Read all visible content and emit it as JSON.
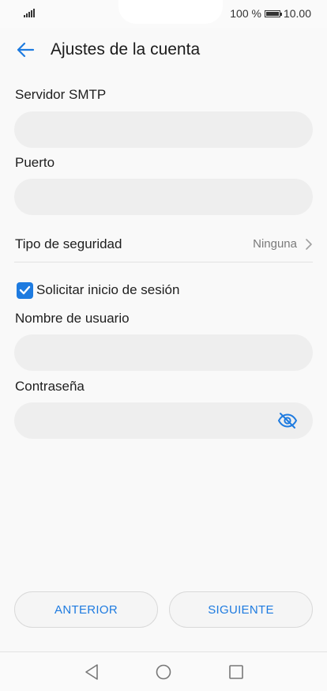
{
  "status_bar": {
    "battery_percent": "100 %",
    "time": "10.00",
    "battery_level": 1.0
  },
  "header": {
    "title": "Ajustes de la cuenta",
    "back_icon": "arrow-left-icon"
  },
  "form": {
    "smtp_server": {
      "label": "Servidor SMTP",
      "value": ""
    },
    "port": {
      "label": "Puerto",
      "value": ""
    },
    "security_type": {
      "label": "Tipo de seguridad",
      "value": "Ninguna"
    },
    "require_login": {
      "label": "Solicitar inicio de sesión",
      "checked": true
    },
    "username": {
      "label": "Nombre de usuario",
      "value": ""
    },
    "password": {
      "label": "Contraseña",
      "value": "",
      "visibility_icon": "eye-off-icon"
    }
  },
  "buttons": {
    "previous": "ANTERIOR",
    "next": "SIGUIENTE"
  },
  "nav": {
    "back_icon": "triangle-back-icon",
    "home_icon": "circle-home-icon",
    "recents_icon": "square-recents-icon"
  },
  "colors": {
    "accent": "#1e7be0",
    "field_background": "#eeeeee",
    "page_background": "#f9f9f9"
  }
}
